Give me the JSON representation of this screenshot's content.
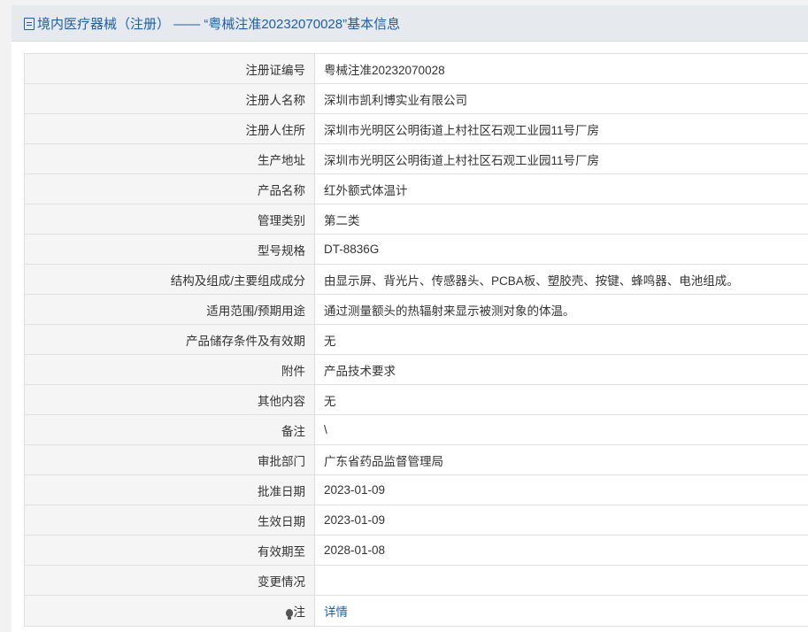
{
  "header": {
    "title": "境内医疗器械（注册） —— “粤械注准20232070028”基本信息",
    "icon": "document-icon"
  },
  "rows": [
    {
      "label": "注册证编号",
      "value": "粤械注准20232070028"
    },
    {
      "label": "注册人名称",
      "value": "深圳市凯利博实业有限公司"
    },
    {
      "label": "注册人住所",
      "value": "深圳市光明区公明街道上村社区石观工业园11号厂房"
    },
    {
      "label": "生产地址",
      "value": "深圳市光明区公明街道上村社区石观工业园11号厂房"
    },
    {
      "label": "产品名称",
      "value": "红外额式体温计"
    },
    {
      "label": "管理类别",
      "value": "第二类"
    },
    {
      "label": "型号规格",
      "value": "DT-8836G"
    },
    {
      "label": "结构及组成/主要组成成分",
      "value": "由显示屏、背光片、传感器头、PCBA板、塑胶壳、按键、蜂鸣器、电池组成。"
    },
    {
      "label": "适用范围/预期用途",
      "value": "通过测量额头的热辐射来显示被测对象的体温。"
    },
    {
      "label": "产品储存条件及有效期",
      "value": "无"
    },
    {
      "label": "附件",
      "value": "产品技术要求"
    },
    {
      "label": "其他内容",
      "value": "无"
    },
    {
      "label": "备注",
      "value": "\\"
    },
    {
      "label": "审批部门",
      "value": "广东省药品监督管理局"
    },
    {
      "label": "批准日期",
      "value": "2023-01-09"
    },
    {
      "label": "生效日期",
      "value": "2023-01-09"
    },
    {
      "label": "有效期至",
      "value": "2028-01-08"
    },
    {
      "label": "变更情况",
      "value": ""
    }
  ],
  "note_row": {
    "label": "注",
    "icon": "lightbulb-icon",
    "link_text": "详情"
  }
}
